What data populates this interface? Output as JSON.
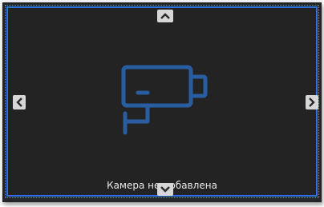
{
  "viewer": {
    "status_text": "Камера не добавлена",
    "icon": "security-camera-icon"
  },
  "controls": {
    "up": "chevron-up-icon",
    "down": "chevron-down-icon",
    "left": "chevron-left-icon",
    "right": "chevron-right-icon"
  },
  "colors": {
    "background": "#232323",
    "border": "#2f6fd6",
    "icon": "#2a5da0",
    "arrow_bg": "#d7d7d7",
    "arrow_fg": "#2a2a2a",
    "text": "#e9e9e9"
  }
}
